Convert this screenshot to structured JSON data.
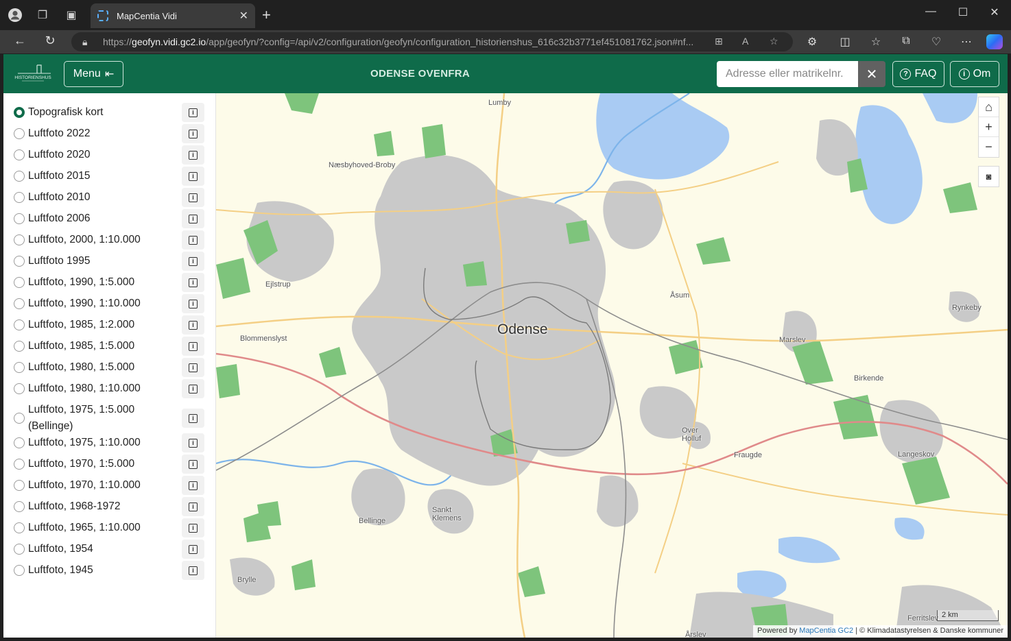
{
  "browser": {
    "tab_title": "MapCentia Vidi",
    "url_prefix": "https://",
    "url_host": "geofyn.vidi.gc2.io",
    "url_rest": "/app/geofyn/?config=/api/v2/configuration/geofyn/configuration_historienshus_616c32b3771ef451081762.json#nf..."
  },
  "header": {
    "logo_text": "HISTORIENSHUS",
    "menu_label": "Menu",
    "title": "ODENSE OVENFRA",
    "search_placeholder": "Adresse eller matrikelnr.",
    "faq_label": "FAQ",
    "about_label": "Om"
  },
  "layers": [
    {
      "label": "Topografisk kort",
      "selected": true
    },
    {
      "label": "Luftfoto 2022",
      "selected": false
    },
    {
      "label": "Luftfoto 2020",
      "selected": false
    },
    {
      "label": "Luftfoto 2015",
      "selected": false
    },
    {
      "label": "Luftfoto 2010",
      "selected": false
    },
    {
      "label": "Luftfoto 2006",
      "selected": false
    },
    {
      "label": "Luftfoto, 2000, 1:10.000",
      "selected": false
    },
    {
      "label": "Luftfoto 1995",
      "selected": false
    },
    {
      "label": "Luftfoto, 1990, 1:5.000",
      "selected": false
    },
    {
      "label": "Luftfoto, 1990, 1:10.000",
      "selected": false
    },
    {
      "label": "Luftfoto, 1985, 1:2.000",
      "selected": false
    },
    {
      "label": "Luftfoto, 1985, 1:5.000",
      "selected": false
    },
    {
      "label": "Luftfoto, 1980, 1:5.000",
      "selected": false
    },
    {
      "label": "Luftfoto, 1980, 1:10.000",
      "selected": false
    },
    {
      "label": "Luftfoto, 1975, 1:5.000 (Bellinge)",
      "selected": false
    },
    {
      "label": "Luftfoto, 1975, 1:10.000",
      "selected": false
    },
    {
      "label": "Luftfoto, 1970, 1:5.000",
      "selected": false
    },
    {
      "label": "Luftfoto, 1970, 1:10.000",
      "selected": false
    },
    {
      "label": "Luftfoto, 1968-1972",
      "selected": false
    },
    {
      "label": "Luftfoto, 1965, 1:10.000",
      "selected": false
    },
    {
      "label": "Luftfoto, 1954",
      "selected": false
    },
    {
      "label": "Luftfoto, 1945",
      "selected": false
    }
  ],
  "map": {
    "city": "Odense",
    "places": {
      "lumby": "Lumby",
      "naesbyhoved": "Næsbyhoved-Broby",
      "ejlstrup": "Ejlstrup",
      "blommenslyst": "Blommenslyst",
      "aasum": "Åsum",
      "marslev": "Marslev",
      "rynkeby": "Rynkeby",
      "birkende": "Birkende",
      "over_holluf_1": "Over",
      "over_holluf_2": "Holluf",
      "fraugde": "Fraugde",
      "langeskov": "Langeskov",
      "bellinge": "Bellinge",
      "sankt_klemens_1": "Sankt",
      "sankt_klemens_2": "Klemens",
      "brylle": "Brylle",
      "ferritslev": "Ferritslev",
      "aarslev": "Årslev"
    },
    "scale_label": "2 km",
    "attribution_prefix": "Powered by",
    "attribution_link": "MapCentia GC2",
    "attribution_suffix": "| © Klimadatastyrelsen & Danske kommuner"
  }
}
